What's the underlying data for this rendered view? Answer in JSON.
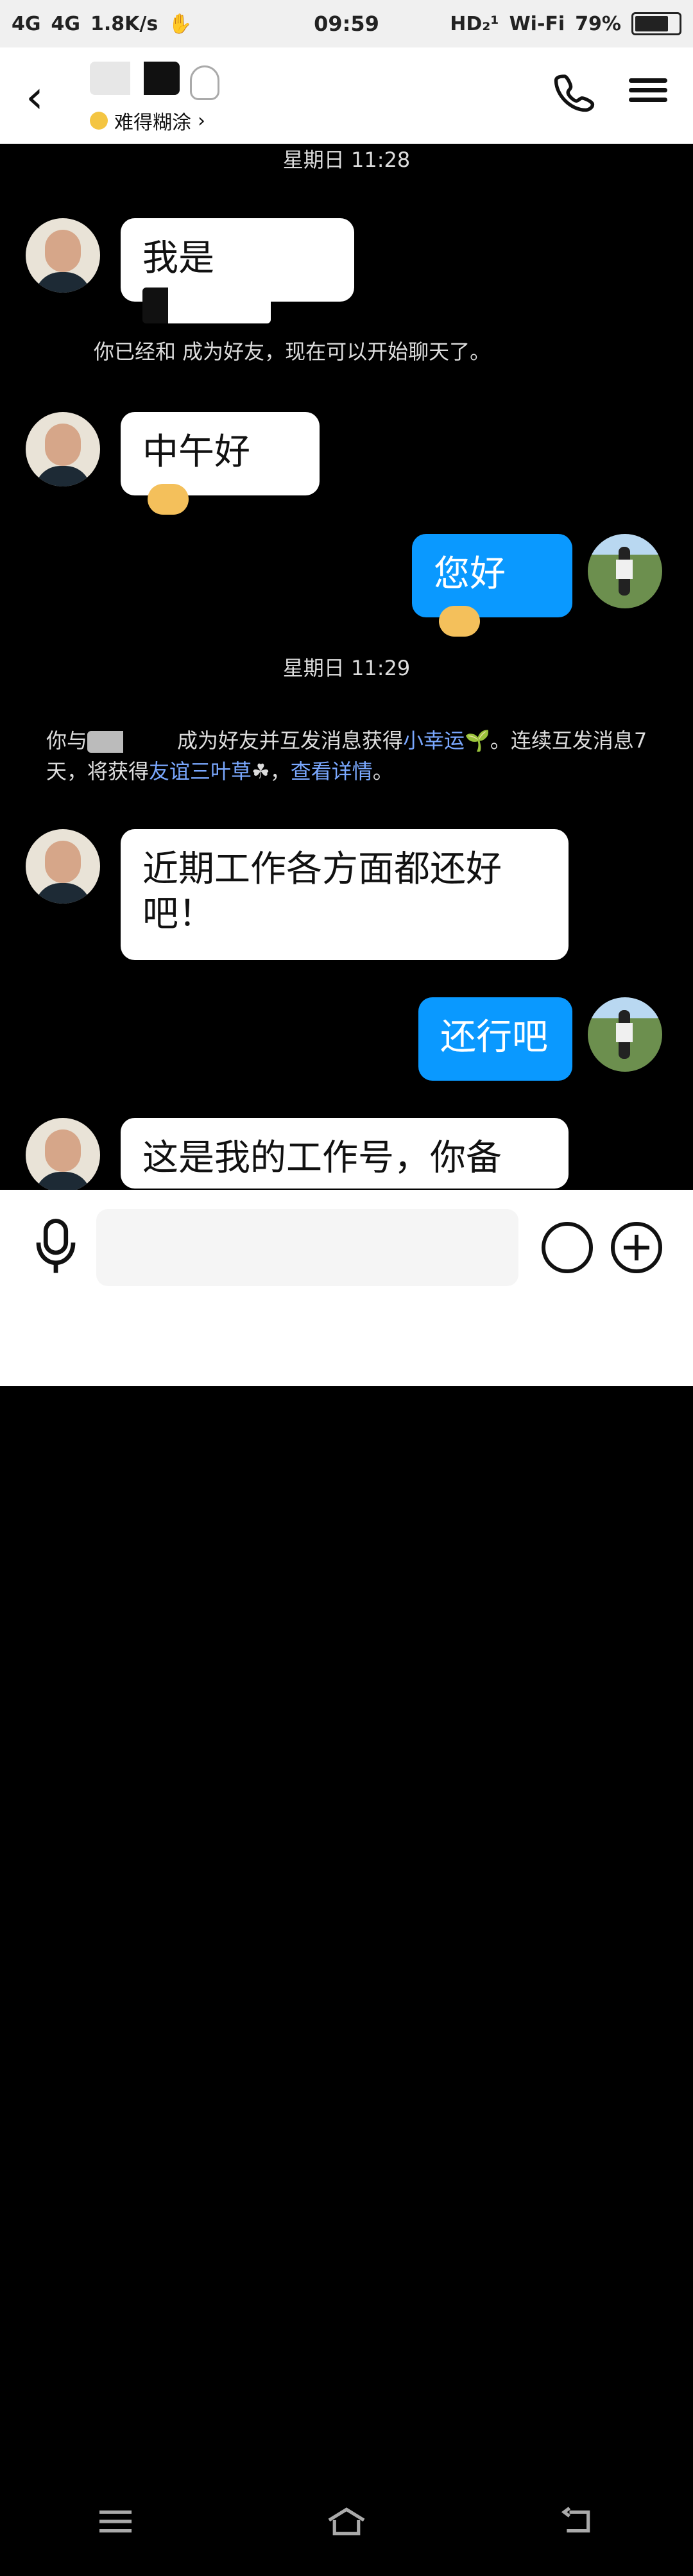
{
  "status_bar": {
    "left_items": [
      "4G",
      "4G",
      "1.8K/s",
      "✋"
    ],
    "time": "09:59",
    "right_items": [
      "HD₂¹",
      "Wi‑Fi",
      "79%"
    ],
    "battery_level": 0.79
  },
  "header": {
    "back_icon": "back-icon",
    "contact_name": "",
    "status_emoji": "😮",
    "status_text": "难得糊涂",
    "call_icon": "phone-icon",
    "menu_icon": "menu-icon"
  },
  "messages": [
    {
      "type": "time",
      "text": "星期日 11:28"
    },
    {
      "type": "incoming",
      "text": "我是"
    },
    {
      "type": "system",
      "text": "你已经和  成为好友，现在可以开始聊天了。"
    },
    {
      "type": "incoming",
      "text": "中午好"
    },
    {
      "type": "outgoing",
      "text": "您好"
    },
    {
      "type": "time",
      "text": "星期日 11:29"
    },
    {
      "type": "system",
      "text_parts": [
        "你与",
        "成为好友并互发消息获得",
        "小幸运",
        "。连续互发消息7天，将获得",
        "友谊三叶草",
        "，",
        "查看详情",
        "。"
      ]
    },
    {
      "type": "incoming",
      "text": "近期工作各方面都还好吧！"
    },
    {
      "type": "outgoing",
      "text": "还行吧"
    },
    {
      "type": "incoming",
      "text": "这是我的工作号，你备"
    }
  ],
  "composer": {
    "mic_icon": "mic-icon",
    "smile_icon": "smile-icon",
    "plus_icon": "plus-icon"
  },
  "nav": {
    "left_icon": "menu-icon",
    "home_icon": "home-icon",
    "back_icon": "back-icon"
  }
}
